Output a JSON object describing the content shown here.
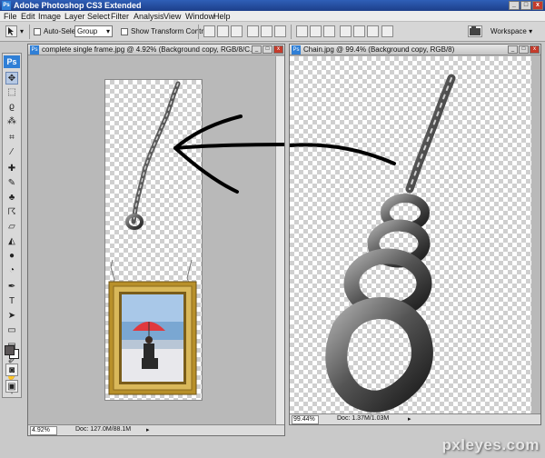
{
  "app": {
    "title": "Adobe Photoshop CS3 Extended"
  },
  "menu": [
    "File",
    "Edit",
    "Image",
    "Layer",
    "Select",
    "Filter",
    "Analysis",
    "View",
    "Window",
    "Help"
  ],
  "options": {
    "auto_select_label": "Auto-Select:",
    "auto_select_value": "Group",
    "show_transform_label": "Show Transform Controls",
    "workspace_label": "Workspace ▾"
  },
  "toolbox": {
    "logo": "Ps"
  },
  "doc_left": {
    "title": "complete single frame.jpg @ 4.92% (Background copy, RGB/8/C...",
    "zoom": "4.92%",
    "doc_info": "Doc: 127.0M/88.1M"
  },
  "doc_right": {
    "title": "Chain.jpg @ 99.4% (Background copy, RGB/8)",
    "zoom": "99.44%",
    "doc_info": "Doc: 1.37M/1.03M"
  },
  "watermark": "pxleyes.com",
  "colors": {
    "title_bar": "#2f5fb8",
    "photoshop_blue": "#2f7fd6",
    "umbrella_red": "#e0393e",
    "frame_gold": "#b8902a"
  }
}
